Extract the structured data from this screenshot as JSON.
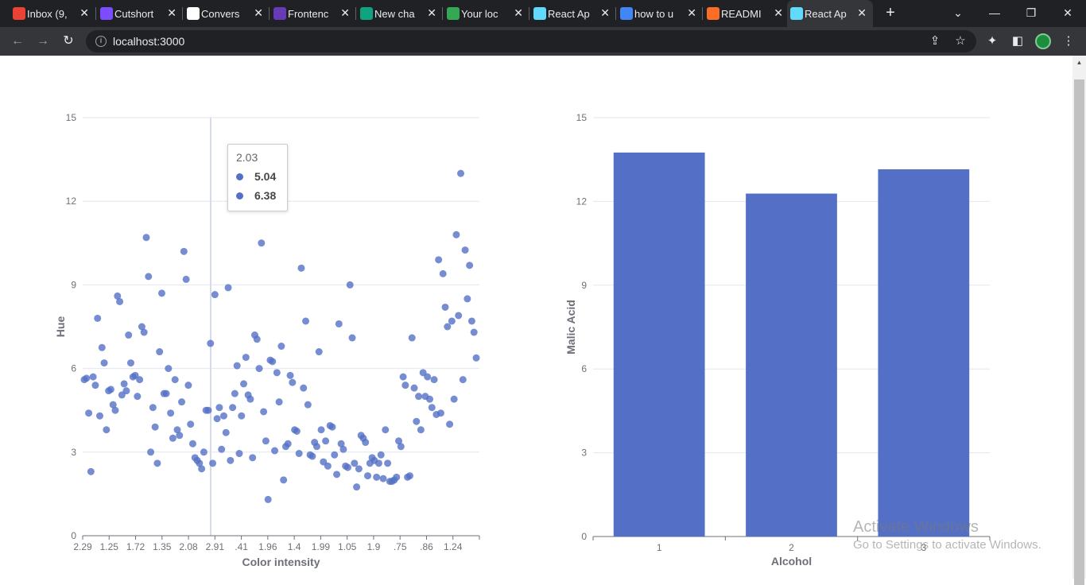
{
  "browser": {
    "tabs": [
      {
        "title": "Inbox (9,",
        "color": "#ea4335"
      },
      {
        "title": "Cutshort",
        "color": "#7c4dff"
      },
      {
        "title": "Convers",
        "color": "#ffffff"
      },
      {
        "title": "Frontenc",
        "color": "#673ab7"
      },
      {
        "title": "New cha",
        "color": "#10a37f"
      },
      {
        "title": "Your loc",
        "color": "#34a853"
      },
      {
        "title": "React Ap",
        "color": "#61dafb"
      },
      {
        "title": "how to u",
        "color": "#4285f4"
      },
      {
        "title": "READMI",
        "color": "#fc6d26"
      },
      {
        "title": "React Ap",
        "color": "#61dafb"
      }
    ],
    "active_tab": 9,
    "url": "localhost:3000"
  },
  "tooltip": {
    "title": "2.03",
    "values": [
      "5.04",
      "6.38"
    ]
  },
  "watermark": {
    "line1": "Activate Windows",
    "line2": "Go to Settings to activate Windows."
  },
  "colors": {
    "series": "#5470c6",
    "axis": "#6e7079",
    "grid": "#e0e6f1"
  },
  "chart_data": [
    {
      "type": "scatter",
      "xlabel": "Color intensity",
      "ylabel": "Hue",
      "ylim": [
        0,
        15
      ],
      "yticks": [
        0,
        3,
        6,
        9,
        12,
        15
      ],
      "x_tick_labels": [
        "2.29",
        "1.25",
        "1.72",
        "1.35",
        "2.08",
        "2.91",
        ".41",
        "1.96",
        "1.4",
        "1.99",
        "1.05",
        "1.9",
        ".75",
        ".86",
        "1.24"
      ],
      "grid": true,
      "point_y_values": [
        5.6,
        5.65,
        4.4,
        2.3,
        5.7,
        5.4,
        7.8,
        4.3,
        6.75,
        6.2,
        3.8,
        5.2,
        5.25,
        4.7,
        4.5,
        8.6,
        8.4,
        5.05,
        5.45,
        5.2,
        7.2,
        6.2,
        5.7,
        5.75,
        5.0,
        5.6,
        7.5,
        7.3,
        10.7,
        9.3,
        3.0,
        4.6,
        3.9,
        2.6,
        6.6,
        8.7,
        5.1,
        5.1,
        6.0,
        4.4,
        3.5,
        5.6,
        3.8,
        3.6,
        4.8,
        10.2,
        9.2,
        5.4,
        4.0,
        3.3,
        2.8,
        2.7,
        2.6,
        2.4,
        3.0,
        4.5,
        4.5,
        6.9,
        2.6,
        8.65,
        4.2,
        4.6,
        3.1,
        4.3,
        3.7,
        8.9,
        2.7,
        4.6,
        5.1,
        6.1,
        2.95,
        4.3,
        5.45,
        6.4,
        5.05,
        4.9,
        2.8,
        7.2,
        7.05,
        6.0,
        10.5,
        4.45,
        3.4,
        1.3,
        6.3,
        6.25,
        3.05,
        5.85,
        4.8,
        6.8,
        2.0,
        3.2,
        3.3,
        5.75,
        5.5,
        3.8,
        3.75,
        2.95,
        9.6,
        5.3,
        7.7,
        4.7,
        2.9,
        2.85,
        3.35,
        3.2,
        6.6,
        3.8,
        2.65,
        3.4,
        2.5,
        3.95,
        3.9,
        2.9,
        2.2,
        7.6,
        3.3,
        3.1,
        2.5,
        2.45,
        9.0,
        7.1,
        2.6,
        1.75,
        2.4,
        3.6,
        3.5,
        3.35,
        2.15,
        2.6,
        2.8,
        2.7,
        2.1,
        2.6,
        2.9,
        2.05,
        3.8,
        2.6,
        1.95,
        1.95,
        2.0,
        2.1,
        3.4,
        3.2,
        5.7,
        5.4,
        2.1,
        2.15,
        7.1,
        5.3,
        4.1,
        5.0,
        3.8,
        5.85,
        5.0,
        5.7,
        4.9,
        4.6,
        5.6,
        4.35,
        9.9,
        4.4,
        9.4,
        8.2,
        7.5,
        4.0,
        7.7,
        4.9,
        10.8,
        7.9,
        13.0,
        5.6,
        10.25,
        8.5,
        9.7,
        7.7,
        7.3,
        6.38
      ]
    },
    {
      "type": "bar",
      "xlabel": "Alcohol",
      "ylabel": "Malic Acid",
      "categories": [
        "1",
        "2",
        "3"
      ],
      "values": [
        13.75,
        12.28,
        13.15
      ],
      "ylim": [
        0,
        15
      ],
      "yticks": [
        0,
        3,
        6,
        9,
        12,
        15
      ],
      "grid": true
    }
  ]
}
